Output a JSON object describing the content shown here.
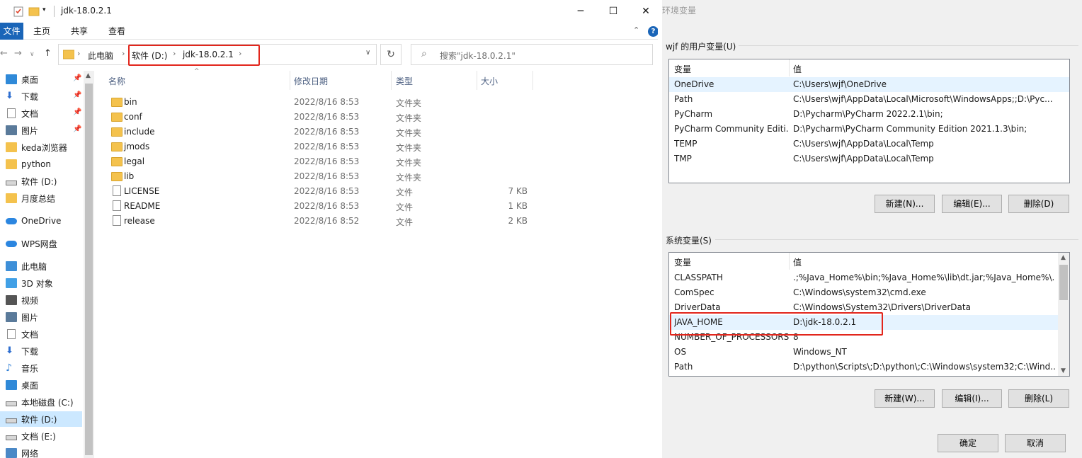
{
  "explorer": {
    "title": "jdk-18.0.2.1",
    "ribbon_tabs": [
      "文件",
      "主页",
      "共享",
      "查看"
    ],
    "help": "?",
    "breadcrumb": [
      "此电脑",
      "软件 (D:)",
      "jdk-18.0.2.1"
    ],
    "search_placeholder": "搜索\"jdk-18.0.2.1\"",
    "sidebar": [
      {
        "label": "桌面",
        "icon": "desktop-icon",
        "pinned": true
      },
      {
        "label": "下载",
        "icon": "download-icon",
        "pinned": true
      },
      {
        "label": "文档",
        "icon": "document-icon",
        "pinned": true
      },
      {
        "label": "图片",
        "icon": "picture-icon",
        "pinned": true
      },
      {
        "label": "keda浏览器",
        "icon": "folder-icon"
      },
      {
        "label": "python",
        "icon": "folder-icon"
      },
      {
        "label": "软件 (D:)",
        "icon": "drive-icon"
      },
      {
        "label": "月度总结",
        "icon": "folder-icon"
      },
      {
        "label": "OneDrive",
        "icon": "cloud-icon"
      },
      {
        "label": "WPS网盘",
        "icon": "cloud-icon"
      },
      {
        "label": "此电脑",
        "icon": "pc-icon"
      },
      {
        "label": "3D 对象",
        "icon": "cube-icon"
      },
      {
        "label": "视频",
        "icon": "video-icon"
      },
      {
        "label": "图片",
        "icon": "picture-icon"
      },
      {
        "label": "文档",
        "icon": "document-icon"
      },
      {
        "label": "下载",
        "icon": "download-icon"
      },
      {
        "label": "音乐",
        "icon": "music-icon"
      },
      {
        "label": "桌面",
        "icon": "desktop-icon"
      },
      {
        "label": "本地磁盘 (C:)",
        "icon": "drive-icon"
      },
      {
        "label": "软件 (D:)",
        "icon": "drive-icon",
        "selected": true
      },
      {
        "label": "文档 (E:)",
        "icon": "drive-icon"
      },
      {
        "label": "网络",
        "icon": "network-icon"
      }
    ],
    "columns": [
      "名称",
      "修改日期",
      "类型",
      "大小"
    ],
    "files": [
      {
        "name": "bin",
        "date": "2022/8/16 8:53",
        "type": "文件夹",
        "size": "",
        "kind": "folder"
      },
      {
        "name": "conf",
        "date": "2022/8/16 8:53",
        "type": "文件夹",
        "size": "",
        "kind": "folder"
      },
      {
        "name": "include",
        "date": "2022/8/16 8:53",
        "type": "文件夹",
        "size": "",
        "kind": "folder"
      },
      {
        "name": "jmods",
        "date": "2022/8/16 8:53",
        "type": "文件夹",
        "size": "",
        "kind": "folder"
      },
      {
        "name": "legal",
        "date": "2022/8/16 8:53",
        "type": "文件夹",
        "size": "",
        "kind": "folder"
      },
      {
        "name": "lib",
        "date": "2022/8/16 8:53",
        "type": "文件夹",
        "size": "",
        "kind": "folder"
      },
      {
        "name": "LICENSE",
        "date": "2022/8/16 8:53",
        "type": "文件",
        "size": "7 KB",
        "kind": "file"
      },
      {
        "name": "README",
        "date": "2022/8/16 8:53",
        "type": "文件",
        "size": "1 KB",
        "kind": "file"
      },
      {
        "name": "release",
        "date": "2022/8/16 8:52",
        "type": "文件",
        "size": "2 KB",
        "kind": "file"
      }
    ]
  },
  "env_dialog": {
    "title": "环境变量",
    "user_group": "wjf 的用户变量(U)",
    "system_group": "系统变量(S)",
    "col_var": "变量",
    "col_val": "值",
    "user_vars": [
      {
        "name": "OneDrive",
        "value": "C:\\Users\\wjf\\OneDrive",
        "selected": true
      },
      {
        "name": "Path",
        "value": "C:\\Users\\wjf\\AppData\\Local\\Microsoft\\WindowsApps;;D:\\Pyc..."
      },
      {
        "name": "PyCharm",
        "value": "D:\\Pycharm\\PyCharm 2022.2.1\\bin;"
      },
      {
        "name": "PyCharm Community Editi...",
        "value": "D:\\Pycharm\\PyCharm Community Edition 2021.1.3\\bin;"
      },
      {
        "name": "TEMP",
        "value": "C:\\Users\\wjf\\AppData\\Local\\Temp"
      },
      {
        "name": "TMP",
        "value": "C:\\Users\\wjf\\AppData\\Local\\Temp"
      }
    ],
    "system_vars": [
      {
        "name": "CLASSPATH",
        "value": ".;%Java_Home%\\bin;%Java_Home%\\lib\\dt.jar;%Java_Home%\\..."
      },
      {
        "name": "ComSpec",
        "value": "C:\\Windows\\system32\\cmd.exe"
      },
      {
        "name": "DriverData",
        "value": "C:\\Windows\\System32\\Drivers\\DriverData"
      },
      {
        "name": "JAVA_HOME",
        "value": "D:\\jdk-18.0.2.1",
        "selected": true
      },
      {
        "name": "NUMBER_OF_PROCESSORS",
        "value": "8"
      },
      {
        "name": "OS",
        "value": "Windows_NT"
      },
      {
        "name": "Path",
        "value": "D:\\python\\Scripts\\;D:\\python\\;C:\\Windows\\system32;C:\\Wind..."
      }
    ],
    "user_buttons": [
      "新建(N)...",
      "编辑(E)...",
      "删除(D)"
    ],
    "system_buttons": [
      "新建(W)...",
      "编辑(I)...",
      "删除(L)"
    ],
    "ok": "确定",
    "cancel": "取消"
  }
}
